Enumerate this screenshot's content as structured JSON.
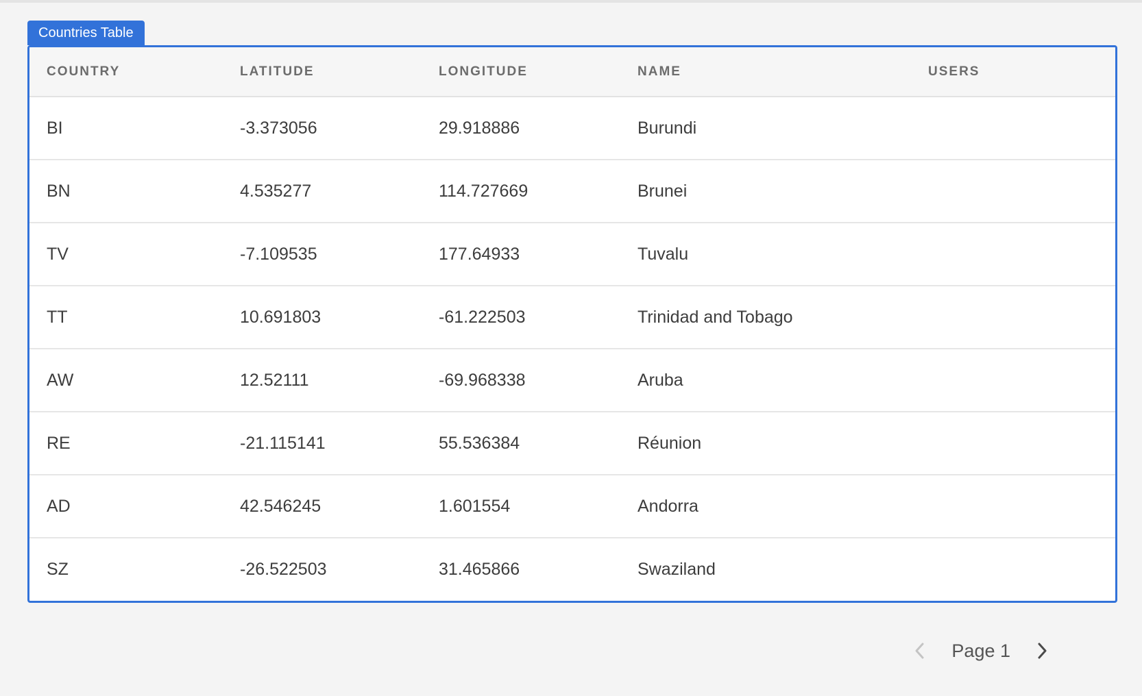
{
  "widget": {
    "title": "Countries Table"
  },
  "table": {
    "columns": [
      "COUNTRY",
      "LATITUDE",
      "LONGITUDE",
      "NAME",
      "USERS"
    ],
    "rows": [
      {
        "country": "BI",
        "latitude": "-3.373056",
        "longitude": "29.918886",
        "name": "Burundi",
        "users": ""
      },
      {
        "country": "BN",
        "latitude": "4.535277",
        "longitude": "114.727669",
        "name": "Brunei",
        "users": ""
      },
      {
        "country": "TV",
        "latitude": "-7.109535",
        "longitude": "177.64933",
        "name": "Tuvalu",
        "users": ""
      },
      {
        "country": "TT",
        "latitude": "10.691803",
        "longitude": "-61.222503",
        "name": "Trinidad and Tobago",
        "users": ""
      },
      {
        "country": "AW",
        "latitude": "12.52111",
        "longitude": "-69.968338",
        "name": "Aruba",
        "users": ""
      },
      {
        "country": "RE",
        "latitude": "-21.115141",
        "longitude": "55.536384",
        "name": "Réunion",
        "users": ""
      },
      {
        "country": "AD",
        "latitude": "42.546245",
        "longitude": "1.601554",
        "name": "Andorra",
        "users": ""
      },
      {
        "country": "SZ",
        "latitude": "-26.522503",
        "longitude": "31.465866",
        "name": "Swaziland",
        "users": ""
      }
    ]
  },
  "pagination": {
    "page_label": "Page 1",
    "prev_icon": "chevron-left-icon",
    "next_icon": "chevron-right-icon"
  },
  "colors": {
    "accent": "#3272d9",
    "background": "#f4f4f4",
    "header_text": "#6c6c6c",
    "cell_text": "#3d3d3d"
  }
}
